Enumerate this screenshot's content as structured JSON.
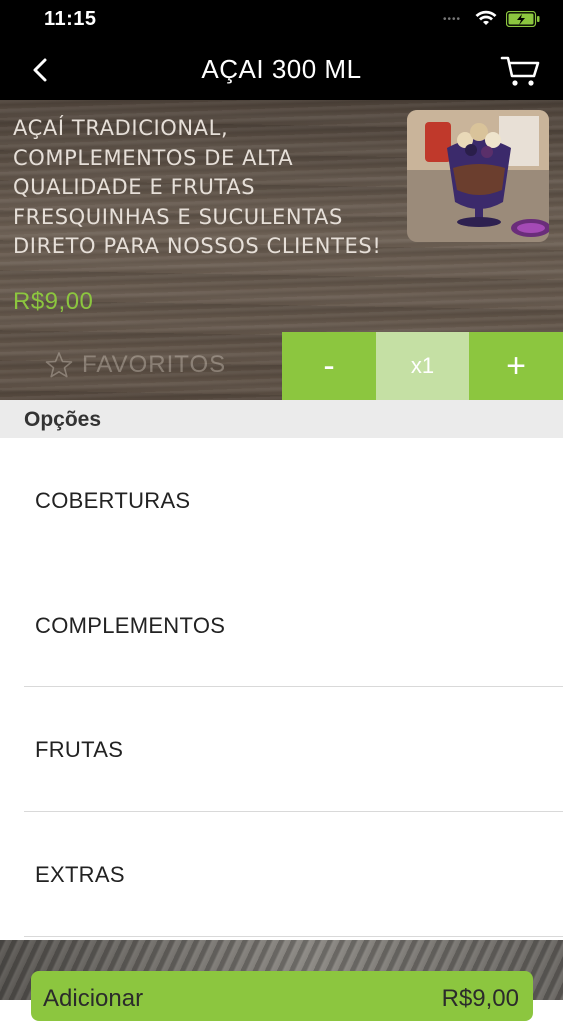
{
  "status_bar": {
    "time": "11:15",
    "signal": "••••"
  },
  "nav": {
    "title": "AÇAI 300 ML"
  },
  "product": {
    "description": "AÇAÍ TRADICIONAL, COMPLEMENTOS DE ALTA QUALIDADE E FRUTAS FRESQUINHAS E SUCULENTAS DIRETO PARA NOSSOS CLIENTES!",
    "price": "R$9,00",
    "favorites_label": "FAVORITOS"
  },
  "quantity": {
    "minus_label": "-",
    "value": "x1",
    "plus_label": "+"
  },
  "options": {
    "header": "Opções",
    "items": [
      {
        "label": "COBERTURAS"
      },
      {
        "label": "COMPLEMENTOS"
      },
      {
        "label": "FRUTAS"
      },
      {
        "label": "EXTRAS"
      }
    ]
  },
  "footer": {
    "add_label": "Adicionar",
    "add_price": "R$9,00"
  },
  "colors": {
    "accent": "#8cc63f",
    "accent_light": "#c5e0a4",
    "bar": "#000000",
    "section_bg": "#ebebeb"
  },
  "icons": [
    "back-arrow-icon",
    "cart-icon",
    "wifi-icon",
    "battery-icon",
    "star-icon",
    "product-photo"
  ]
}
